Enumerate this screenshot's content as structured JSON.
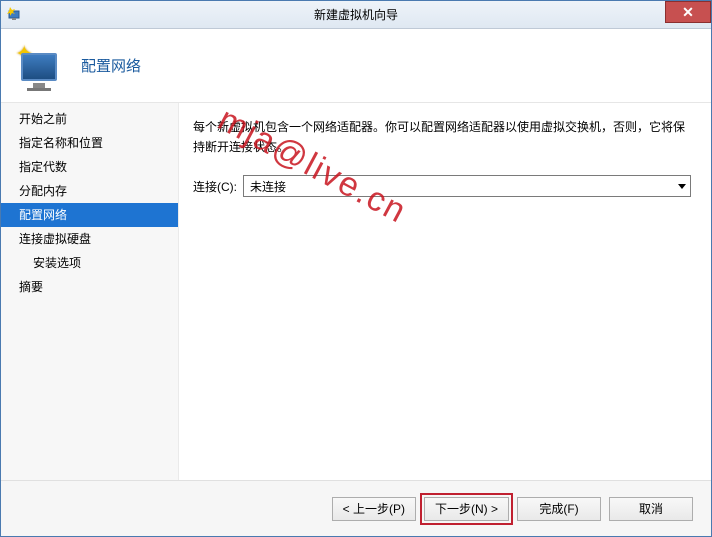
{
  "titlebar": {
    "title": "新建虚拟机向导"
  },
  "header": {
    "title": "配置网络"
  },
  "sidebar": {
    "items": [
      {
        "label": "开始之前",
        "active": false,
        "indent": false
      },
      {
        "label": "指定名称和位置",
        "active": false,
        "indent": false
      },
      {
        "label": "指定代数",
        "active": false,
        "indent": false
      },
      {
        "label": "分配内存",
        "active": false,
        "indent": false
      },
      {
        "label": "配置网络",
        "active": true,
        "indent": false
      },
      {
        "label": "连接虚拟硬盘",
        "active": false,
        "indent": false
      },
      {
        "label": "安装选项",
        "active": false,
        "indent": true
      },
      {
        "label": "摘要",
        "active": false,
        "indent": false
      }
    ]
  },
  "content": {
    "description": "每个新虚拟机包含一个网络适配器。你可以配置网络适配器以使用虚拟交换机，否则，它将保持断开连接状态。",
    "connection_label": "连接(C):",
    "connection_value": "未连接"
  },
  "footer": {
    "prev": "< 上一步(P)",
    "next": "下一步(N) >",
    "finish": "完成(F)",
    "cancel": "取消"
  },
  "watermark": "mja@live.cn"
}
